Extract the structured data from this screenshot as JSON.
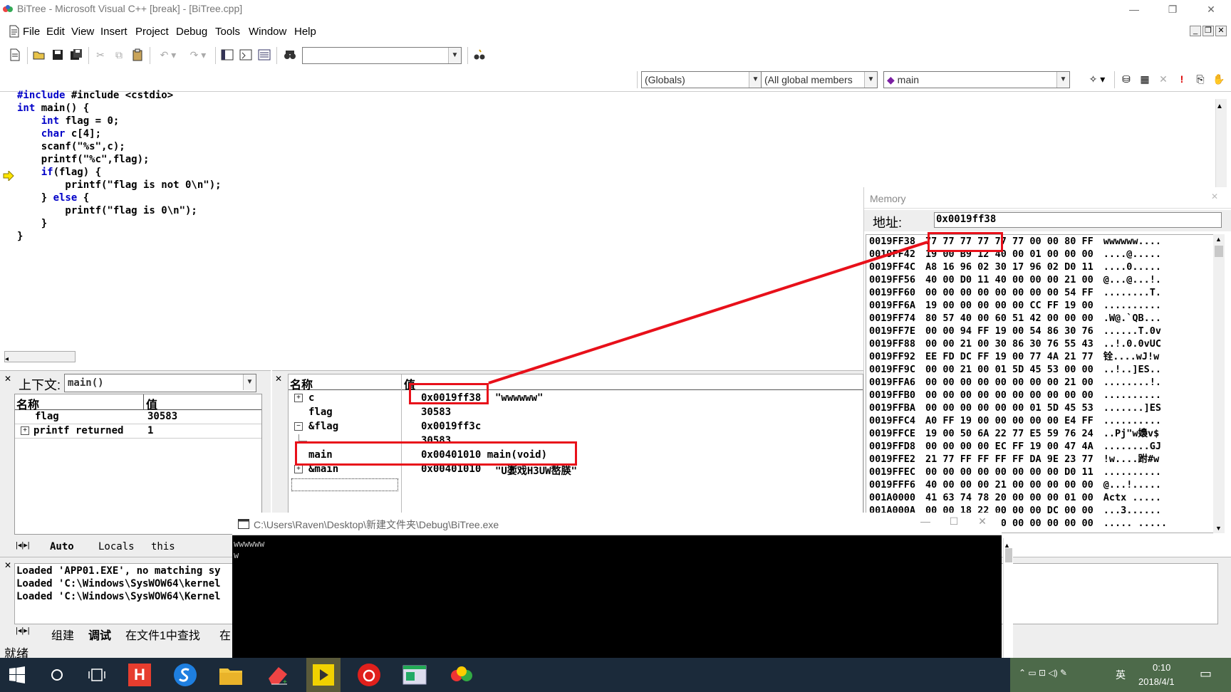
{
  "window": {
    "title": "BiTree - Microsoft Visual C++ [break] - [BiTree.cpp]"
  },
  "menu": [
    "File",
    "Edit",
    "View",
    "Insert",
    "Project",
    "Debug",
    "Tools",
    "Window",
    "Help"
  ],
  "toolbar": {
    "find_value": "",
    "globals_combo": "(Globals)",
    "members_combo": "(All global members",
    "function_combo": "main"
  },
  "code": [
    "#include <cstdio>",
    "int main() {",
    "    int flag = 0;",
    "    char c[4];",
    "    scanf(\"%s\",c);",
    "    printf(\"%c\",flag);",
    "    if(flag) {",
    "        printf(\"flag is not 0\\n\");",
    "    } else {",
    "        printf(\"flag is 0\\n\");",
    "    }",
    "}"
  ],
  "variables": {
    "context_label": "上下文:",
    "context_value": "main()",
    "col_name": "名称",
    "col_value": "值",
    "rows": [
      {
        "name": "flag",
        "value": "30583"
      },
      {
        "name": "printf returned",
        "value": "1"
      }
    ],
    "tabs": [
      "Auto",
      "Locals",
      "this"
    ]
  },
  "watch": {
    "col_name": "名称",
    "col_value": "值",
    "rows": [
      {
        "name": "c",
        "value": "0x0019ff38",
        "extra": "\"wwwwww\""
      },
      {
        "name": "flag",
        "value": "30583",
        "extra": ""
      },
      {
        "name": "&flag",
        "value": "0x0019ff3c",
        "extra": ""
      },
      {
        "name": "",
        "value": "30583",
        "extra": ""
      },
      {
        "name": "main",
        "value": "0x00401010 main(void)",
        "extra": ""
      },
      {
        "name": "&main",
        "value": "0x00401010",
        "extra": "\"U嬱戏H3UW嶅朠\""
      }
    ]
  },
  "memory": {
    "title": "Memory",
    "address_label": "地址:",
    "address_value": "0x0019ff38",
    "rows": [
      {
        "addr": "0019FF38",
        "bytes": "77 77 77 77 77 77 00 00 80 FF",
        "ascii": "wwwwww...."
      },
      {
        "addr": "0019FF42",
        "bytes": "19 00 B9 12 40 00 01 00 00 00",
        "ascii": "....@....."
      },
      {
        "addr": "0019FF4C",
        "bytes": "A8 16 96 02 30 17 96 02 D0 11",
        "ascii": "....0....."
      },
      {
        "addr": "0019FF56",
        "bytes": "40 00 D0 11 40 00 00 00 21 00",
        "ascii": "@...@...!."
      },
      {
        "addr": "0019FF60",
        "bytes": "00 00 00 00 00 00 00 00 54 FF",
        "ascii": "........T."
      },
      {
        "addr": "0019FF6A",
        "bytes": "19 00 00 00 00 00 CC FF 19 00",
        "ascii": ".........."
      },
      {
        "addr": "0019FF74",
        "bytes": "80 57 40 00 60 51 42 00 00 00",
        "ascii": ".W@.`QB..."
      },
      {
        "addr": "0019FF7E",
        "bytes": "00 00 94 FF 19 00 54 86 30 76",
        "ascii": "......T.0v"
      },
      {
        "addr": "0019FF88",
        "bytes": "00 00 21 00 30 86 30 76 55 43",
        "ascii": "..!.0.0vUC"
      },
      {
        "addr": "0019FF92",
        "bytes": "EE FD DC FF 19 00 77 4A 21 77",
        "ascii": "铨....wJ!w"
      },
      {
        "addr": "0019FF9C",
        "bytes": "00 00 21 00 01 5D 45 53 00 00",
        "ascii": "..!..]ES.."
      },
      {
        "addr": "0019FFA6",
        "bytes": "00 00 00 00 00 00 00 00 21 00",
        "ascii": "........!."
      },
      {
        "addr": "0019FFB0",
        "bytes": "00 00 00 00 00 00 00 00 00 00",
        "ascii": ".........."
      },
      {
        "addr": "0019FFBA",
        "bytes": "00 00 00 00 00 00 01 5D 45 53",
        "ascii": ".......]ES"
      },
      {
        "addr": "0019FFC4",
        "bytes": "A0 FF 19 00 00 00 00 00 E4 FF",
        "ascii": ".........."
      },
      {
        "addr": "0019FFCE",
        "bytes": "19 00 50 6A 22 77 E5 59 76 24",
        "ascii": "..Pj\"w嬝v$"
      },
      {
        "addr": "0019FFD8",
        "bytes": "00 00 00 00 EC FF 19 00 47 4A",
        "ascii": "........GJ"
      },
      {
        "addr": "0019FFE2",
        "bytes": "21 77 FF FF FF FF DA 9E 23 77",
        "ascii": "!w....跗#w"
      },
      {
        "addr": "0019FFEC",
        "bytes": "00 00 00 00 00 00 00 00 D0 11",
        "ascii": ".........."
      },
      {
        "addr": "0019FFF6",
        "bytes": "40 00 00 00 21 00 00 00 00 00",
        "ascii": "@...!....."
      },
      {
        "addr": "001A0000",
        "bytes": "41 63 74 78 20 00 00 00 01 00",
        "ascii": "Actx ....."
      },
      {
        "addr": "001A000A",
        "bytes": "00 00 18 22 00 00 00 DC 00 00",
        "ascii": "...3......"
      },
      {
        "addr": "001A0014",
        "bytes": "00 00 00 00 00 00 00 00 00 00",
        "ascii": "..... ....."
      }
    ]
  },
  "output": {
    "lines": [
      "Loaded 'APP01.EXE', no matching sy",
      "Loaded 'C:\\Windows\\SysWOW64\\kernel",
      "Loaded 'C:\\Windows\\SysWOW64\\Kernel"
    ],
    "tabs": [
      "组建",
      "调试",
      "在文件1中查找",
      "在"
    ]
  },
  "console": {
    "title": "C:\\Users\\Raven\\Desktop\\新建文件夹\\Debug\\BiTree.exe",
    "lines": [
      "wwwwww",
      "w"
    ]
  },
  "status": {
    "text": "就绪"
  },
  "taskbar": {
    "time": "0:10",
    "date": "2018/4/1",
    "ime": "英"
  }
}
